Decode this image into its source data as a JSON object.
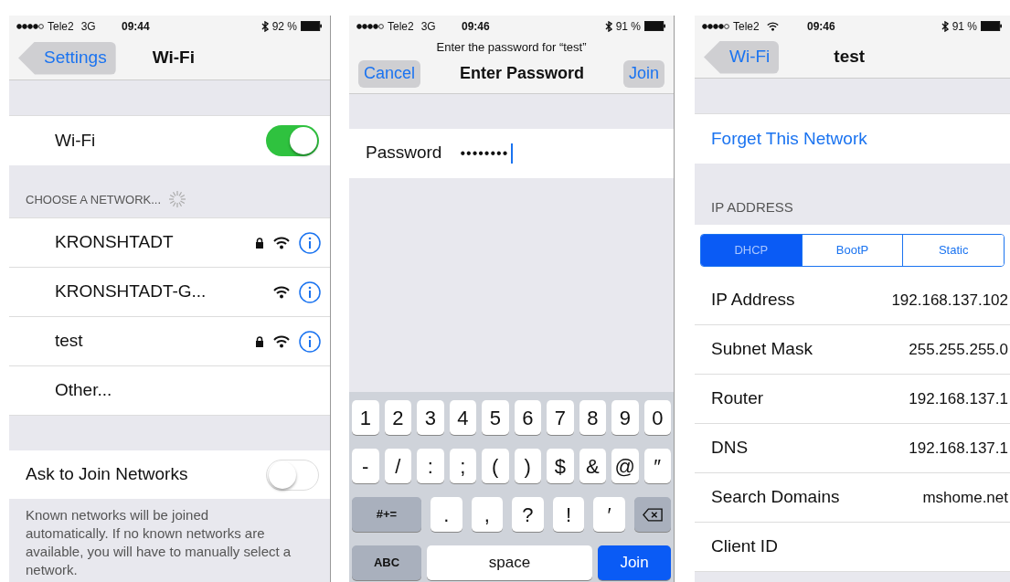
{
  "screens": [
    {
      "status": {
        "carrier": "Tele2",
        "connection": {
          "kind": "text",
          "label": "3G"
        },
        "time": "09:44",
        "battery": "92 %"
      },
      "nav": {
        "back": "Settings",
        "title": "Wi-Fi"
      },
      "wifi_row": {
        "label": "Wi-Fi",
        "on": true
      },
      "section_header": "CHOOSE A NETWORK...",
      "networks": [
        {
          "name": "KRONSHTADT",
          "locked": true
        },
        {
          "name": "KRONSHTADT-G...",
          "locked": false
        },
        {
          "name": "test",
          "locked": true
        }
      ],
      "other": "Other...",
      "ask_row": {
        "label": "Ask to Join Networks",
        "on": false
      },
      "footer": "Known networks will be joined automatically. If no known networks are available, you will have to manually select a network."
    },
    {
      "status": {
        "carrier": "Tele2",
        "connection": {
          "kind": "text",
          "label": "3G"
        },
        "time": "09:46",
        "battery": "91 %"
      },
      "prompt": "Enter the password for “test”",
      "nav": {
        "cancel": "Cancel",
        "title": "Enter Password",
        "join": "Join"
      },
      "password": {
        "label": "Password",
        "value": "••••••••"
      },
      "keyboard": [
        [
          {
            "kind": "char",
            "label": "1"
          },
          {
            "kind": "char",
            "label": "2"
          },
          {
            "kind": "char",
            "label": "3"
          },
          {
            "kind": "char",
            "label": "4"
          },
          {
            "kind": "char",
            "label": "5"
          },
          {
            "kind": "char",
            "label": "6"
          },
          {
            "kind": "char",
            "label": "7"
          },
          {
            "kind": "char",
            "label": "8"
          },
          {
            "kind": "char",
            "label": "9"
          },
          {
            "kind": "char",
            "label": "0"
          }
        ],
        [
          {
            "kind": "char",
            "label": "-"
          },
          {
            "kind": "char",
            "label": "/"
          },
          {
            "kind": "char",
            "label": ":"
          },
          {
            "kind": "char",
            "label": ";"
          },
          {
            "kind": "char",
            "label": "("
          },
          {
            "kind": "char",
            "label": ")"
          },
          {
            "kind": "char",
            "label": "$"
          },
          {
            "kind": "char",
            "label": "&"
          },
          {
            "kind": "char",
            "label": "@"
          },
          {
            "kind": "char",
            "label": "″"
          }
        ],
        [
          {
            "kind": "mode",
            "label": "#+="
          },
          {
            "kind": "wide",
            "label": "."
          },
          {
            "kind": "wide",
            "label": ","
          },
          {
            "kind": "wide",
            "label": "?"
          },
          {
            "kind": "wide",
            "label": "!"
          },
          {
            "kind": "wide",
            "label": "′"
          },
          {
            "kind": "delete"
          }
        ],
        [
          {
            "kind": "mode",
            "label": "ABC"
          },
          {
            "kind": "space",
            "label": "space"
          },
          {
            "kind": "action",
            "label": "Join"
          }
        ]
      ]
    },
    {
      "status": {
        "carrier": "Tele2",
        "connection": {
          "kind": "wifi"
        },
        "time": "09:46",
        "battery": "91 %"
      },
      "nav": {
        "back": "Wi-Fi",
        "title": "test"
      },
      "forget": "Forget This Network",
      "section_header": "IP ADDRESS",
      "segments": [
        {
          "label": "DHCP",
          "selected": true
        },
        {
          "label": "BootP",
          "selected": false
        },
        {
          "label": "Static",
          "selected": false
        }
      ],
      "rows": [
        {
          "label": "IP Address",
          "value": "192.168.137.102"
        },
        {
          "label": "Subnet Mask",
          "value": "255.255.255.0"
        },
        {
          "label": "Router",
          "value": "192.168.137.1"
        },
        {
          "label": "DNS",
          "value": "192.168.137.1"
        },
        {
          "label": "Search Domains",
          "value": "mshome.net"
        },
        {
          "label": "Client ID"
        }
      ]
    }
  ]
}
